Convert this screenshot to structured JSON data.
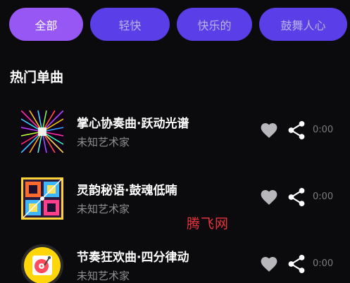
{
  "tabs": [
    {
      "label": "全部",
      "active": true
    },
    {
      "label": "轻快",
      "active": false
    },
    {
      "label": "快乐的",
      "active": false
    },
    {
      "label": "鼓舞人心",
      "active": false
    }
  ],
  "section": {
    "title": "热门单曲"
  },
  "songs": [
    {
      "title": "掌心协奏曲·跃动光谱",
      "artist": "未知艺术家",
      "duration": "0:00",
      "cover_icon": "neon-tunnel-cover"
    },
    {
      "title": "灵韵秘语·鼓魂低喃",
      "artist": "未知艺术家",
      "duration": "0:00",
      "cover_icon": "colorful-grid-cover"
    },
    {
      "title": "节奏狂欢曲·四分律动",
      "artist": "未知艺术家",
      "duration": "0:00",
      "cover_icon": "record-player-cover"
    }
  ],
  "icons": {
    "like": "heart-icon",
    "share": "share-icon"
  },
  "watermark": "腾飞网",
  "colors": {
    "background": "#0b0b0d",
    "chip_active": "#9657f4",
    "chip_inactive": "#5a3ee8",
    "watermark": "#e8343c"
  }
}
